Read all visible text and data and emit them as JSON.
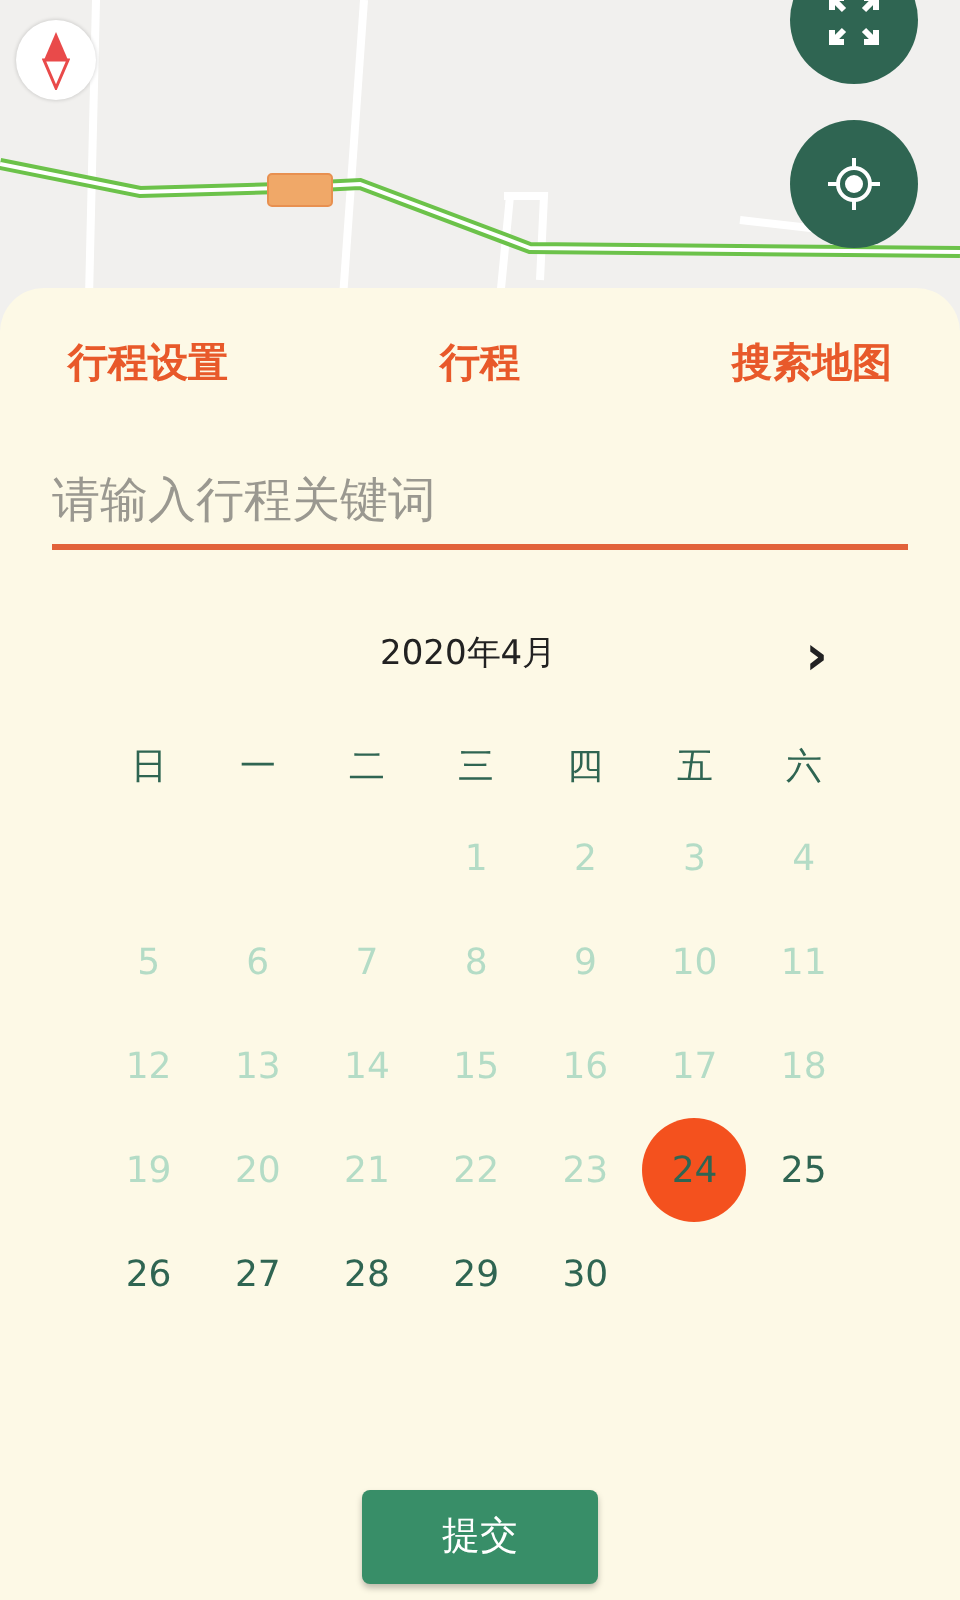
{
  "map_controls": [
    {
      "kind": "compass"
    },
    {
      "kind": "fullscreen"
    },
    {
      "kind": "locate"
    }
  ],
  "tabs": [
    {
      "label": "行程设置"
    },
    {
      "label": "行程"
    },
    {
      "label": "搜索地图"
    }
  ],
  "search": {
    "placeholder": "请输入行程关键词"
  },
  "calendar": {
    "month": "2020年4月",
    "next": "›",
    "weekdays": [
      "日",
      "一",
      "二",
      "三",
      "四",
      "五",
      "六"
    ],
    "weeks": [
      [
        {
          "day": "1",
          "disabled": true,
          "selected": false
        },
        {
          "day": "2",
          "disabled": true,
          "selected": false
        },
        {
          "day": "3",
          "disabled": true,
          "selected": false
        },
        {
          "day": "4",
          "disabled": true,
          "selected": false
        }
      ],
      [
        {
          "day": "5",
          "disabled": true,
          "selected": false
        },
        {
          "day": "6",
          "disabled": true,
          "selected": false
        },
        {
          "day": "7",
          "disabled": true,
          "selected": false
        },
        {
          "day": "8",
          "disabled": true,
          "selected": false
        },
        {
          "day": "9",
          "disabled": true,
          "selected": false
        },
        {
          "day": "10",
          "disabled": true,
          "selected": false
        },
        {
          "day": "11",
          "disabled": true,
          "selected": false
        }
      ],
      [
        {
          "day": "12",
          "disabled": true,
          "selected": false
        },
        {
          "day": "13",
          "disabled": true,
          "selected": false
        },
        {
          "day": "14",
          "disabled": true,
          "selected": false
        },
        {
          "day": "15",
          "disabled": true,
          "selected": false
        },
        {
          "day": "16",
          "disabled": true,
          "selected": false
        },
        {
          "day": "17",
          "disabled": true,
          "selected": false
        },
        {
          "day": "18",
          "disabled": true,
          "selected": false
        }
      ],
      [
        {
          "day": "19",
          "disabled": true,
          "selected": false
        },
        {
          "day": "20",
          "disabled": true,
          "selected": false
        },
        {
          "day": "21",
          "disabled": true,
          "selected": false
        },
        {
          "day": "22",
          "disabled": true,
          "selected": false
        },
        {
          "day": "23",
          "disabled": true,
          "selected": false
        },
        {
          "day": "24",
          "disabled": false,
          "selected": true
        },
        {
          "day": "25",
          "disabled": false,
          "selected": false
        }
      ],
      [
        {
          "day": "26",
          "disabled": false,
          "selected": false
        },
        {
          "day": "27",
          "disabled": false,
          "selected": false
        },
        {
          "day": "28",
          "disabled": false,
          "selected": false
        },
        {
          "day": "29",
          "disabled": false,
          "selected": false
        },
        {
          "day": "30",
          "disabled": false,
          "selected": false
        }
      ]
    ]
  },
  "submit": "提交"
}
